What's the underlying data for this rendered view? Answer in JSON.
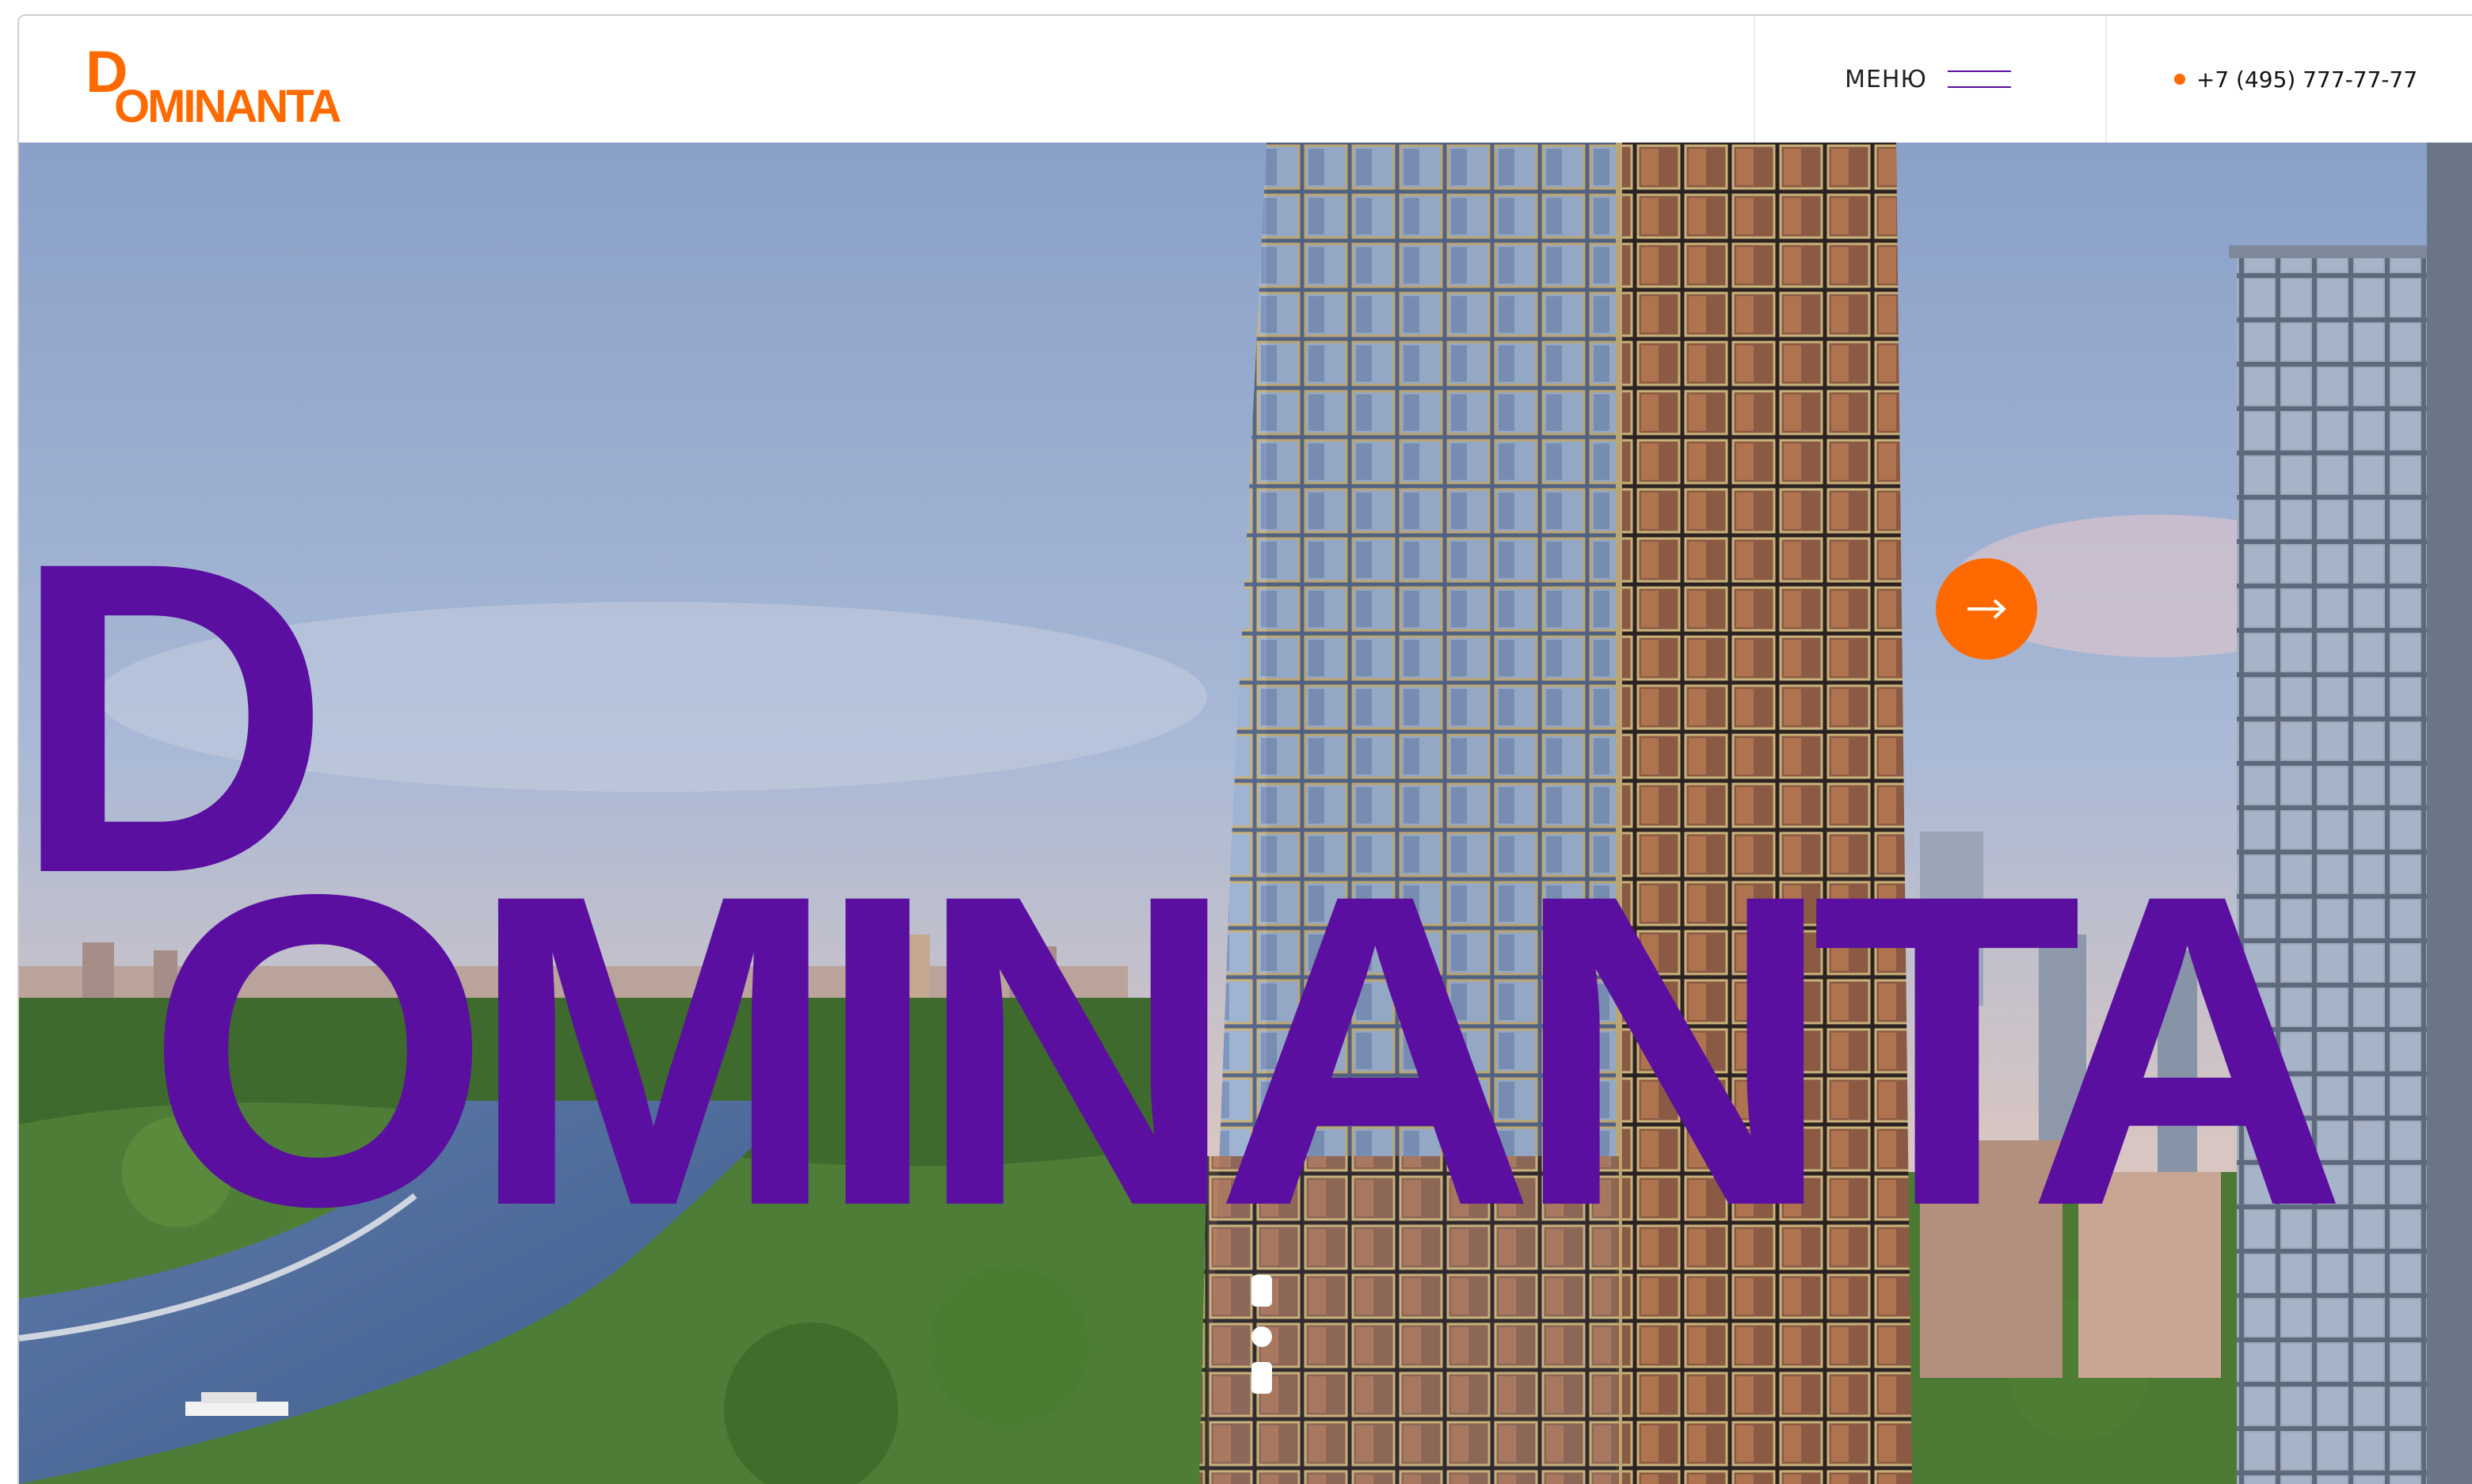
{
  "brand": {
    "name": "DOMINANTA",
    "logo_letters": {
      "top": "D",
      "rest": "OMINANTA"
    },
    "accent_color": "#ff6a00",
    "brand_purple": "#5a0fa0"
  },
  "header": {
    "menu_label": "МЕНЮ",
    "phone": "+7 (495) 777-77-77"
  },
  "hero": {
    "headline_top": "D",
    "headline_rest": "OMINANTA",
    "next_button_icon": "arrow-right-icon",
    "scroll_icon": "scroll-indicator-icon"
  }
}
